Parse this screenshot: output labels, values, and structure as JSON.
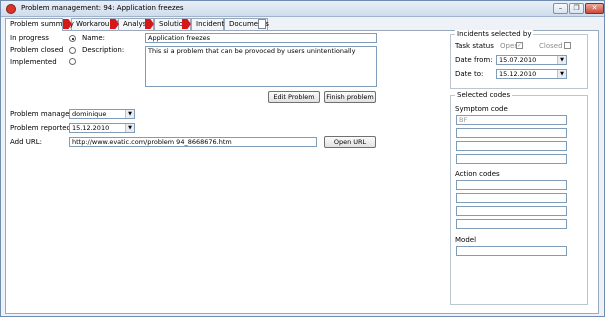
{
  "window": {
    "title": "Problem management: 94: Application freezes",
    "minimize_glyph": "–",
    "restore_glyph": "❐",
    "close_glyph": "✕"
  },
  "tabs": [
    {
      "label": "Problem summary",
      "icon": "red-flag-icon"
    },
    {
      "label": "Workaround",
      "icon": "red-flag-icon"
    },
    {
      "label": "Analysis",
      "icon": "red-flag-icon"
    },
    {
      "label": "Solution",
      "icon": "red-flag-icon"
    },
    {
      "label": "Incidents",
      "icon": ""
    },
    {
      "label": "Documents",
      "icon": "page-icon"
    }
  ],
  "status": {
    "options": [
      {
        "label": "In progress",
        "selected": true
      },
      {
        "label": "Problem closed",
        "selected": false
      },
      {
        "label": "Implemented",
        "selected": false
      }
    ]
  },
  "details": {
    "name_label": "Name:",
    "name_value": "Application freezes",
    "description_label": "Description:",
    "description_value": "This si a problem that can be provoced by users unintentionally",
    "edit_button": "Edit Problem",
    "finish_button": "Finish problem"
  },
  "meta": {
    "manager_label": "Problem manager",
    "manager_value": "dominique",
    "reported_label": "Problem reported:",
    "reported_value": "15.12.2010",
    "url_label": "Add URL:",
    "url_value": "http://www.evatic.com/problem 94_8668676.htm",
    "open_url_button": "Open URL"
  },
  "incidents_filter": {
    "title": "Incidents selected by",
    "task_status_label": "Task status",
    "open_label": "Open",
    "open_checked": true,
    "closed_label": "Closed",
    "closed_checked": false,
    "date_from_label": "Date from:",
    "date_from_value": "15.07.2010",
    "date_to_label": "Date to:",
    "date_to_value": "15.12.2010"
  },
  "selected_codes": {
    "title": "Selected codes",
    "symptom_label": "Symptom code",
    "symptom_values": [
      "BF",
      "",
      "",
      ""
    ],
    "action_label": "Action codes",
    "action_values": [
      "",
      "",
      "",
      ""
    ],
    "model_label": "Model",
    "model_value": ""
  }
}
